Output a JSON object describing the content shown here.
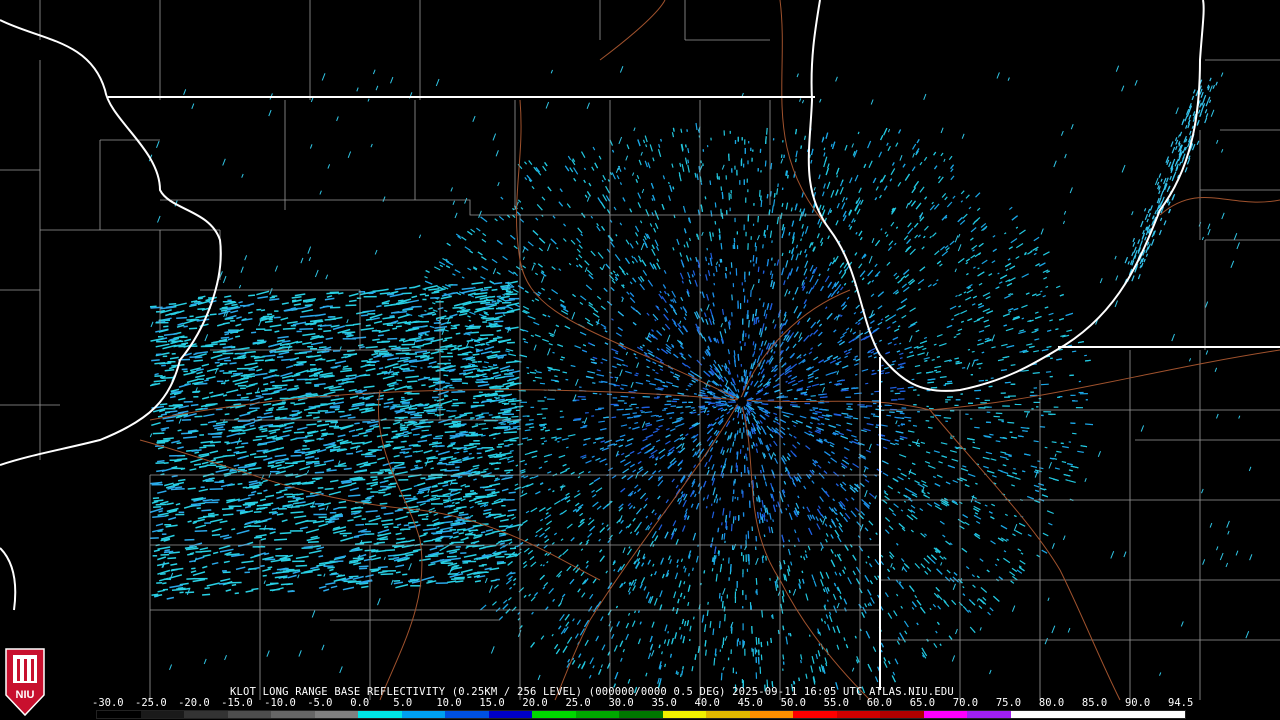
{
  "caption": "KLOT LONG RANGE BASE REFLECTIVITY (0.25KM / 256 LEVEL) (000000/0000 0.5 DEG) 2025-09-11 16:05 UTC  ATLAS.NIU.EDU",
  "logo": {
    "text": "NIU",
    "color": "#c8102e"
  },
  "color_scale": {
    "labels": [
      "-30.0",
      "-25.0",
      "-20.0",
      "-15.0",
      "-10.0",
      "-5.0",
      "0.0",
      "5.0",
      "10.0",
      "15.0",
      "20.0",
      "25.0",
      "30.0",
      "35.0",
      "40.0",
      "45.0",
      "50.0",
      "55.0",
      "60.0",
      "65.0",
      "70.0",
      "75.0",
      "80.0",
      "85.0",
      "90.0",
      "94.5"
    ],
    "colors": [
      "#000000",
      "#1a1a1a",
      "#333333",
      "#4d4d4d",
      "#666666",
      "#808080",
      "#00e5e5",
      "#00a0f0",
      "#0050e0",
      "#0000c8",
      "#00d800",
      "#00a800",
      "#007800",
      "#f0f000",
      "#e0b800",
      "#ff9000",
      "#ff0000",
      "#d00000",
      "#b00000",
      "#ff00ff",
      "#a020f0",
      "#ffffff",
      "#ffffff",
      "#ffffff",
      "#ffffff"
    ]
  },
  "radar": {
    "site": "KLOT"
  }
}
